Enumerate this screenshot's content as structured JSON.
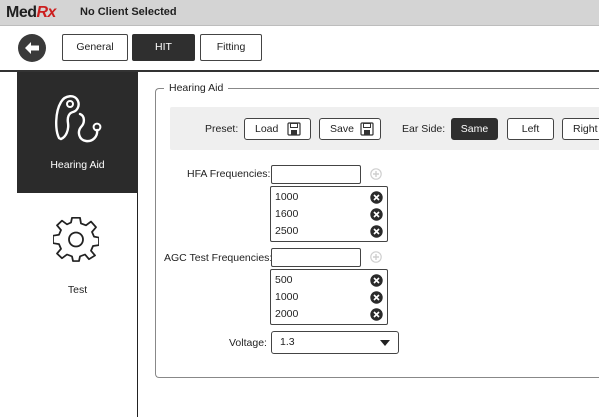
{
  "titlebar": {
    "logo_med": "Med",
    "logo_rx": "Rx",
    "client_status": "No Client Selected"
  },
  "tabs": [
    {
      "label": "General",
      "active": false
    },
    {
      "label": "HIT",
      "active": true
    },
    {
      "label": "Fitting",
      "active": false
    }
  ],
  "sidebar": {
    "items": [
      {
        "label": "Hearing Aid",
        "icon": "hearing-aid-icon",
        "active": true
      },
      {
        "label": "Test",
        "icon": "gear-icon",
        "active": false
      }
    ]
  },
  "group": {
    "title": "Hearing Aid"
  },
  "preset": {
    "label": "Preset:",
    "load_label": "Load",
    "save_label": "Save",
    "ear_side_label": "Ear Side:",
    "ear_sides": [
      {
        "label": "Same",
        "active": true
      },
      {
        "label": "Left",
        "active": false
      },
      {
        "label": "Right",
        "active": false
      }
    ]
  },
  "hfa": {
    "label": "HFA Frequencies:",
    "input_value": "",
    "values": [
      "1000",
      "1600",
      "2500"
    ]
  },
  "agc": {
    "label": "AGC Test Frequencies:",
    "input_value": "",
    "values": [
      "500",
      "1000",
      "2000"
    ]
  },
  "voltage": {
    "label": "Voltage:",
    "value": "1.3"
  },
  "colors": {
    "accent_dark": "#2f2f2f",
    "brand_red": "#cc1e1e",
    "titlebar_bg": "#d4d4d4",
    "preset_bg": "#efefef"
  }
}
